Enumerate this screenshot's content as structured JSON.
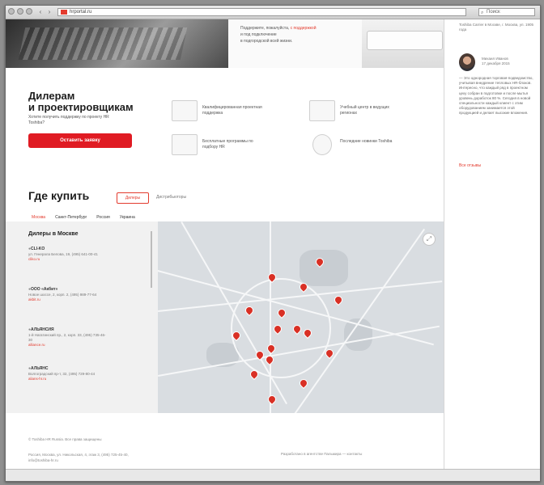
{
  "browser": {
    "address": "hrportal.ru",
    "search_placeholder": "Поиск",
    "back_label": "‹",
    "forward_label": "›"
  },
  "hero": {
    "text_line1": "Поддержите, пожалуйста, ",
    "text_link": "с поддержкой",
    "text_line2": "и под подключение",
    "text_line3": "в подгородской всей жизни."
  },
  "dealers": {
    "title_line1": "Дилерам",
    "title_line2": "и проектировщикам",
    "subtitle": "Хотите получить поддержку по проекту HR Toshiba?",
    "cta_label": "Оставить заявку",
    "features": [
      {
        "icon": "certificate-icon",
        "text": "Квалифицированная проектная поддержка"
      },
      {
        "icon": "document-icon",
        "text": "Учебный центр в ведущих регионах"
      },
      {
        "icon": "monitor-icon",
        "text": "Бесплатные программы по подбору HR"
      },
      {
        "icon": "lightbulb-icon",
        "text": "Последние новинки Toshiba"
      }
    ]
  },
  "where": {
    "title": "Где купить",
    "tab_active": "Дилеры",
    "tab_inactive": "Дистрибьюторы",
    "cities": [
      "Москва",
      "Санкт-Петербург",
      "Россия",
      "Украина"
    ],
    "active_city": "Москва"
  },
  "dealer_list": {
    "title": "Дилеры в Москве",
    "entries": [
      {
        "name": "CLI-KO",
        "address": "ул. Генерала Белова, 19, (495) 641-00-41",
        "link": "cliko.ru"
      },
      {
        "name": "ООО «Акбит»",
        "address": "Новое шоссе, 2, корп. 2, (495) 989-77-64",
        "link": "akbit.ru"
      },
      {
        "name": "АЛЬЯНСИЯ",
        "address": "1-й Нагатинский пр., 2, корп. 33, (495) 735-46-30",
        "link": "alliance.ru"
      },
      {
        "name": "АЛЬЯНС",
        "address": "Волгоградский пр-т, 32, (495) 729-80-44",
        "link": "alians-hr.ru"
      }
    ]
  },
  "map": {
    "zoom_label": "⤢"
  },
  "footer": {
    "line1": "© Toshiba HR Russia. Все права защищены",
    "line2": "Россия, Москва, ул. Никольская, 4, этаж 3, (495) 725-45-40, info@toshiba-hr.ru",
    "line3": "Разработано в агентстве Пальмира — контакты"
  },
  "sidebar": {
    "top_text": "Toshiba Carrier в Москве, г. Москва, ул. 1905 года",
    "author_name": "Михаил Иванов",
    "author_date": "17 декабря 2015",
    "quote": "— Это однородная торговая-подведомство, учитывая внедрение тепловых HR-блоков. Интересно, что каждый ряд в проектном цеху собран в подготовке и после мытья уровень доработок 80 %. Сегодня в новой специальности каждый клиент с этим оборудованием занимается этой продукцией и делает высокие вложения.",
    "more_label": "Все отзывы"
  }
}
